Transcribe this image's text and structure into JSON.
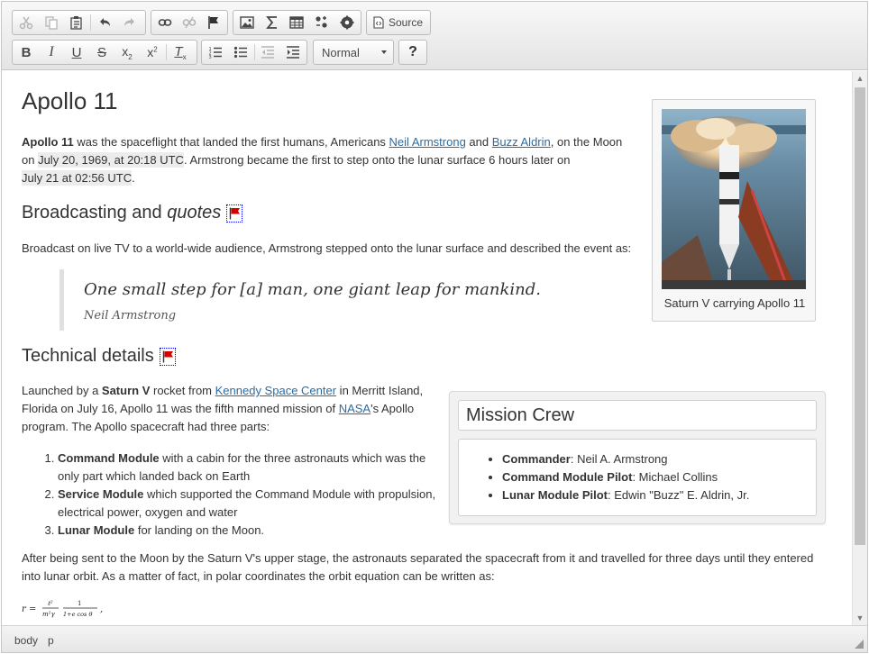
{
  "toolbar": {
    "row1": [
      {
        "name": "cut-button",
        "icon": "scissors-icon",
        "disabled": true
      },
      {
        "name": "copy-button",
        "icon": "copy-icon",
        "disabled": true
      },
      {
        "name": "paste-button",
        "icon": "clipboard-icon",
        "disabled": false
      },
      {
        "name": "undo-button",
        "icon": "undo-icon",
        "disabled": false
      },
      {
        "name": "redo-button",
        "icon": "redo-icon",
        "disabled": true
      },
      {
        "name": "link-button",
        "icon": "link-icon",
        "disabled": false
      },
      {
        "name": "unlink-button",
        "icon": "unlink-icon",
        "disabled": true
      },
      {
        "name": "anchor-button",
        "icon": "flag-icon",
        "disabled": false
      },
      {
        "name": "image-button",
        "icon": "image-icon",
        "disabled": false
      },
      {
        "name": "math-button",
        "icon": "sigma-icon",
        "disabled": false
      },
      {
        "name": "table-button",
        "icon": "table-icon",
        "disabled": false
      },
      {
        "name": "special-char-button",
        "icon": "omega-icon",
        "disabled": false
      },
      {
        "name": "plugin-button",
        "icon": "gear-icon",
        "disabled": false
      }
    ],
    "source_label": "Source",
    "format": {
      "selected": "Normal"
    },
    "help_label": "?"
  },
  "content": {
    "title": "Apollo 11",
    "intro": {
      "strong": "Apollo 11",
      "t1": " was the spaceflight that landed the first humans, Americans ",
      "link1": "Neil Armstrong",
      "t2": " and ",
      "link2": "Buzz Aldrin",
      "t3": ", on the Moon",
      "t4": "on ",
      "date1": "July 20, 1969, at 20:18 UTC",
      "t5": ". Armstrong became the first to step onto the lunar surface 6 hours later on",
      "date2": "July 21 at 02:56 UTC",
      "t6": "."
    },
    "h_broadcast": "Broadcasting and ",
    "h_broadcast_em": "quotes",
    "broadcast_text": "Broadcast on live TV to a world-wide audience, Armstrong stepped onto the lunar surface and described the event as:",
    "quote": "One small step for [a] man, one giant leap for mankind.",
    "quote_cite": "Neil Armstrong",
    "figure_caption": "Saturn V carrying Apollo 11",
    "h_technical": "Technical details",
    "launch": {
      "t1": "Launched by a ",
      "strong": "Saturn V",
      "t2": " rocket from ",
      "link1": "Kennedy Space Center",
      "t3": " in Merritt Island,",
      "t4": "Florida on July 16, Apollo 11 was the fifth manned mission of ",
      "link2": "NASA",
      "t5": "'s Apollo",
      "t6": "program. The Apollo spacecraft had three parts:"
    },
    "parts": [
      {
        "name": "Command Module",
        "text": " with a cabin for the three astronauts which was the only part which landed back on Earth"
      },
      {
        "name": "Service Module",
        "text": " which supported the Command Module with propulsion, electrical power, oxygen and water"
      },
      {
        "name": "Lunar Module",
        "text": " for landing on the Moon."
      }
    ],
    "crew": {
      "title": "Mission Crew",
      "members": [
        {
          "role": "Commander",
          "name": ": Neil A. Armstrong"
        },
        {
          "role": "Command Module Pilot",
          "name": ": Michael Collins"
        },
        {
          "role": "Lunar Module Pilot",
          "name": ": Edwin \"Buzz\" E. Aldrin, Jr."
        }
      ]
    },
    "after_text_1": "After being sent to the Moon by the Saturn V's upper stage, the astronauts separated the spacecraft from it and travelled for three days until they entered",
    "after_text_2": "into lunar orbit. As a matter of fact, in polar coordinates the orbit equation can be written as:",
    "formula": {
      "lhs": "r =",
      "n1": "ℓ²",
      "d1": "m²γ",
      "n2": "1",
      "d2": "1+e cos θ",
      "tail": ","
    }
  },
  "statusbar": {
    "crumbs": [
      "body",
      "p"
    ]
  },
  "colors": {
    "link": "#2b6ca3",
    "flag": "#d40000",
    "toolbar_bg": "#e9e9e9"
  }
}
